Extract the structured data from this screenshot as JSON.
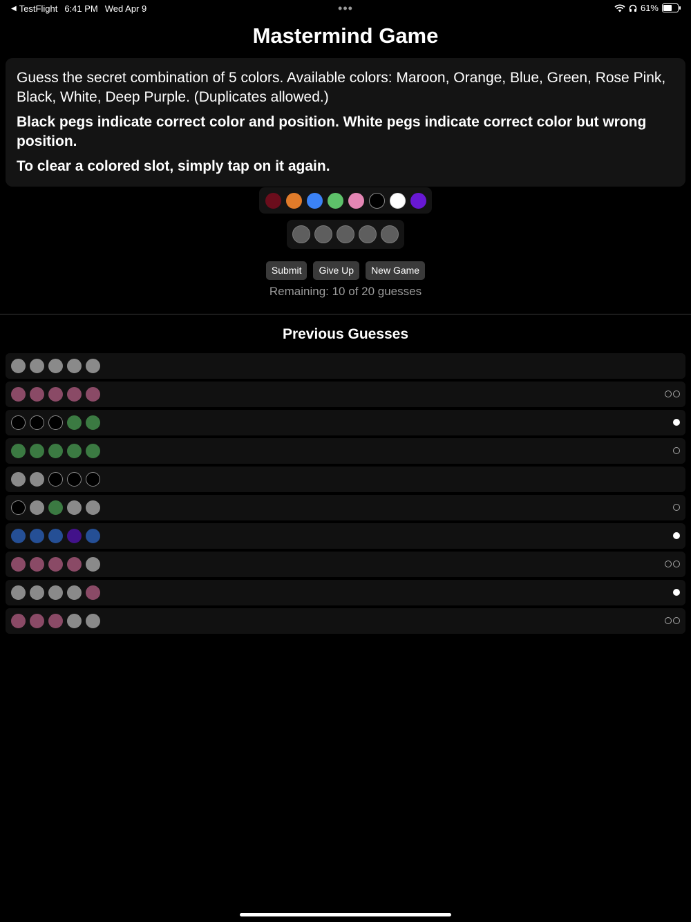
{
  "status_bar": {
    "back_app": "TestFlight",
    "time": "6:41 PM",
    "date": "Wed Apr 9",
    "battery": "61%",
    "battery_level": 0.61
  },
  "title": "Mastermind Game",
  "instructions": [
    "Guess the secret combination of 5 colors. Available colors: Maroon, Orange, Blue, Green, Rose Pink, Black, White, Deep Purple. (Duplicates allowed.)",
    "Black pegs indicate correct color and position. White pegs indicate correct color but wrong position.",
    "To clear a colored slot, simply tap on it again."
  ],
  "colors": {
    "maroon": "#6b0d1c",
    "orange": "#e07b2a",
    "blue": "#3b82f6",
    "green": "#5ec26a",
    "rose_pink": "#e486b4",
    "black": "#000000",
    "white": "#ffffff",
    "deep_purple": "#6818d4",
    "empty": "#8a8a8a",
    "dim_rose": "#8a4a66",
    "dim_green": "#3b7a42",
    "dim_blue": "#254f95",
    "dim_purple": "#42128a"
  },
  "palette": [
    "maroon",
    "orange",
    "blue",
    "green",
    "rose_pink",
    "black",
    "white",
    "deep_purple"
  ],
  "current_guess": [
    "empty",
    "empty",
    "empty",
    "empty",
    "empty"
  ],
  "buttons": {
    "submit": "Submit",
    "give_up": "Give Up",
    "new_game": "New Game"
  },
  "remaining": "Remaining: 10 of 20 guesses",
  "previous_title": "Previous Guesses",
  "previous_guesses": [
    {
      "pegs": [
        "empty",
        "empty",
        "empty",
        "empty",
        "empty"
      ],
      "feedback": []
    },
    {
      "pegs": [
        "dim_rose",
        "dim_rose",
        "dim_rose",
        "dim_rose",
        "dim_rose"
      ],
      "feedback": [
        "black",
        "black"
      ]
    },
    {
      "pegs": [
        "black",
        "black",
        "black",
        "dim_green",
        "dim_green"
      ],
      "feedback": [
        "white"
      ]
    },
    {
      "pegs": [
        "dim_green",
        "dim_green",
        "dim_green",
        "dim_green",
        "dim_green"
      ],
      "feedback": [
        "black"
      ]
    },
    {
      "pegs": [
        "empty",
        "empty",
        "black",
        "black",
        "black"
      ],
      "feedback": []
    },
    {
      "pegs": [
        "black",
        "empty",
        "dim_green",
        "empty",
        "empty"
      ],
      "feedback": [
        "black"
      ]
    },
    {
      "pegs": [
        "dim_blue",
        "dim_blue",
        "dim_blue",
        "dim_purple",
        "dim_blue"
      ],
      "feedback": [
        "white"
      ]
    },
    {
      "pegs": [
        "dim_rose",
        "dim_rose",
        "dim_rose",
        "dim_rose",
        "empty"
      ],
      "feedback": [
        "black",
        "black"
      ]
    },
    {
      "pegs": [
        "empty",
        "empty",
        "empty",
        "empty",
        "dim_rose"
      ],
      "feedback": [
        "white"
      ]
    },
    {
      "pegs": [
        "dim_rose",
        "dim_rose",
        "dim_rose",
        "empty",
        "empty"
      ],
      "feedback": [
        "black",
        "black"
      ]
    }
  ]
}
